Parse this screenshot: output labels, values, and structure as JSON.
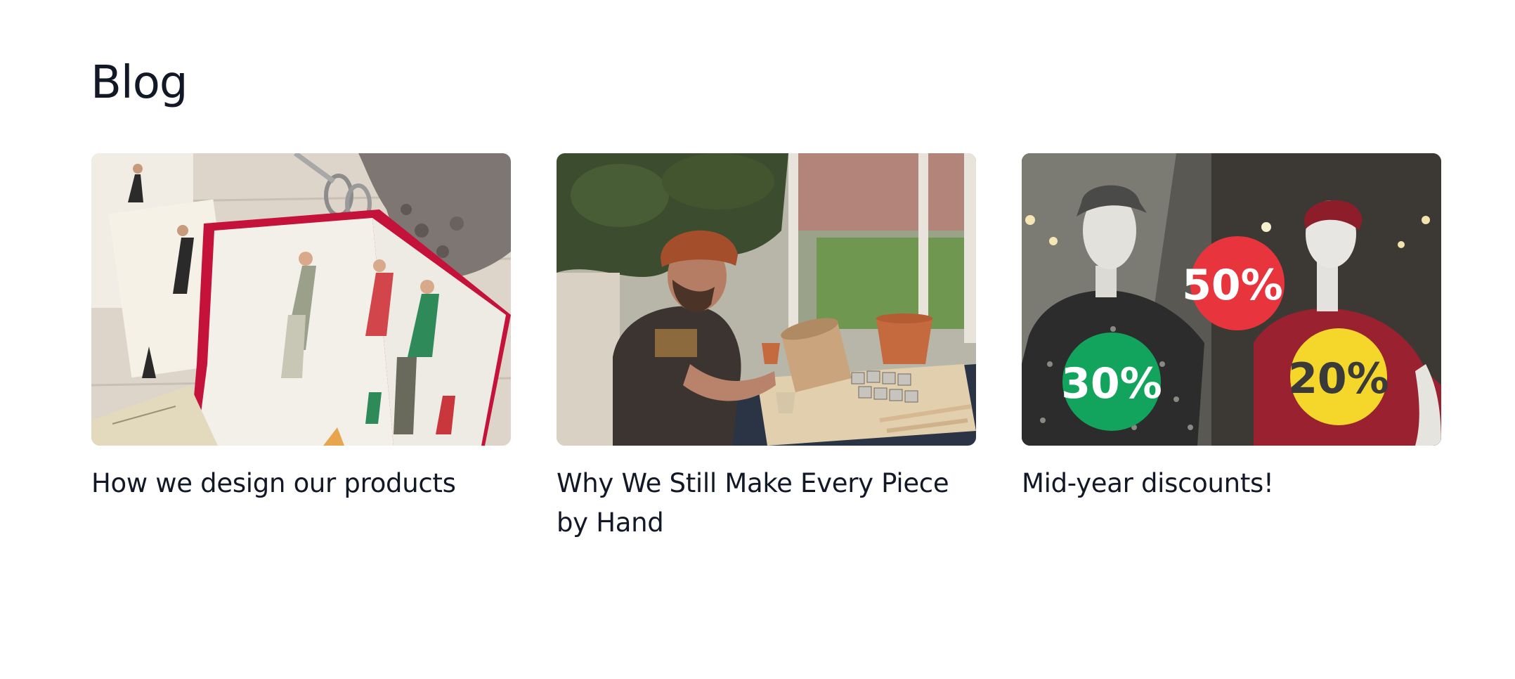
{
  "section": {
    "title": "Blog"
  },
  "posts": [
    {
      "title": "How we design our products",
      "image": "fashion-sketches-magazine"
    },
    {
      "title": "Why We Still Make Every Piece by Hand",
      "image": "potter-crafting"
    },
    {
      "title": "Mid-year discounts!",
      "image": "mannequins-sale",
      "badges": [
        "50%",
        "30%",
        "20%"
      ]
    }
  ],
  "colors": {
    "text": "#131826",
    "badge_red": "#e8343d",
    "badge_green": "#12a45c",
    "badge_yellow": "#f5d62a"
  }
}
